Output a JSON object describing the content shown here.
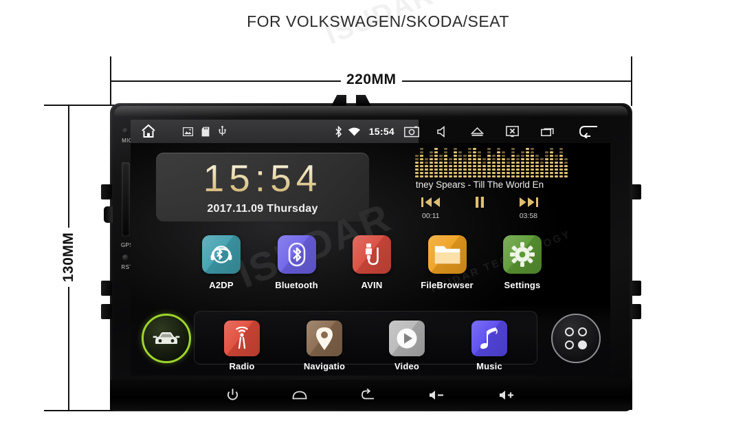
{
  "header": {
    "title": "FOR VOLKSWAGEN/SKODA/SEAT"
  },
  "dimensions": {
    "width_label": "220MM",
    "height_label": "130MM"
  },
  "device": {
    "side_ports": [
      {
        "label": "MIC"
      },
      {
        "label": "GPS"
      },
      {
        "label": "RST"
      }
    ]
  },
  "statusbar": {
    "left_icons": [
      {
        "name": "home-icon"
      },
      {
        "name": "gallery-icon"
      },
      {
        "name": "sdcard-icon"
      },
      {
        "name": "usb-icon"
      }
    ],
    "bluetooth": "bluetooth-icon",
    "wifi": "wifi-icon",
    "time": "15:54",
    "right_icons": [
      {
        "name": "camera-icon"
      },
      {
        "name": "mute-speaker-icon"
      },
      {
        "name": "eject-icon"
      },
      {
        "name": "screen-off-icon"
      },
      {
        "name": "recent-apps-icon"
      },
      {
        "name": "back-arrow-icon"
      }
    ]
  },
  "clock_widget": {
    "time": "15:54",
    "date": "2017.11.09 Thursday"
  },
  "music_widget": {
    "track": "tney Spears - Till The World En",
    "elapsed": "00:11",
    "duration": "03:58",
    "controls": [
      {
        "name": "previous-track-button"
      },
      {
        "name": "pause-button"
      },
      {
        "name": "next-track-button"
      }
    ],
    "equalizer_levels": [
      5,
      7,
      4,
      6,
      9,
      5,
      7,
      4,
      8,
      6,
      5,
      7,
      9,
      6,
      4,
      7,
      5,
      8,
      6,
      4,
      7,
      5,
      6,
      9,
      7,
      5,
      4,
      6,
      8,
      5,
      7,
      4
    ]
  },
  "apps": [
    {
      "label": "A2DP",
      "icon": "a2dp-icon",
      "color": "#3f9fae"
    },
    {
      "label": "Bluetooth",
      "icon": "bluetooth-icon",
      "color": "#6d62e8"
    },
    {
      "label": "AVIN",
      "icon": "avin-icon",
      "color": "#d94a3d"
    },
    {
      "label": "FileBrowser",
      "icon": "folder-icon",
      "color": "#f0a01e"
    },
    {
      "label": "Settings",
      "icon": "gear-icon",
      "color": "#5c9a33"
    }
  ],
  "dock": {
    "car_button": {
      "name": "car-mode-button"
    },
    "items": [
      {
        "label": "Radio",
        "icon": "radio-icon",
        "color": "#e14b3a"
      },
      {
        "label": "Navigatio",
        "icon": "location-pin-icon",
        "color": "#8a6b4f"
      },
      {
        "label": "Video",
        "icon": "play-icon",
        "color": "#b9b9b9"
      },
      {
        "label": "Music",
        "icon": "music-note-icon",
        "color": "#5a4bf0"
      }
    ],
    "apps_button": {
      "name": "all-apps-button"
    }
  },
  "hardware_buttons": [
    {
      "name": "power-button",
      "glyph": "power"
    },
    {
      "name": "home-button",
      "glyph": "home"
    },
    {
      "name": "back-button",
      "glyph": "back"
    },
    {
      "name": "volume-down-button",
      "glyph": "vol-down"
    },
    {
      "name": "volume-up-button",
      "glyph": "vol-up"
    }
  ],
  "watermark": {
    "brand": "ISUDAR",
    "sub": "ISUDAR TECHNOLOGY"
  },
  "colors": {
    "accent_green": "#9fd62b",
    "clock_gold": "#e0bf72",
    "statusbar_left": "#353537",
    "statusbar_right": "#0b0b0c"
  }
}
